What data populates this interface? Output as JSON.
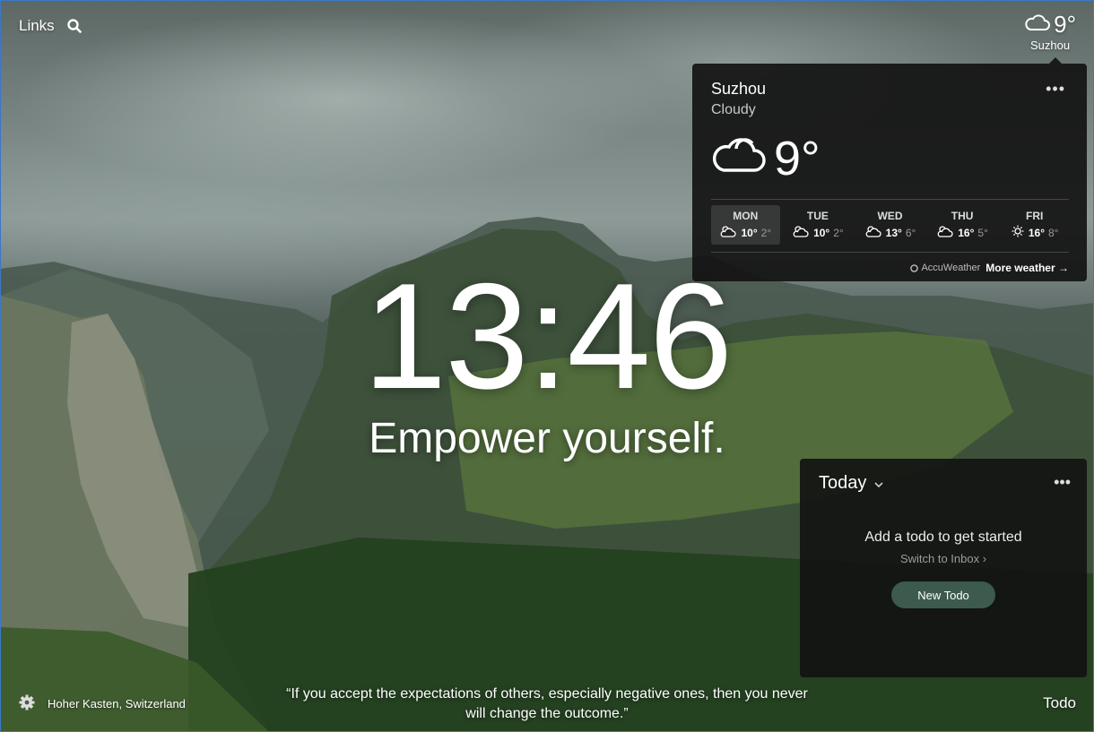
{
  "topbar": {
    "links_label": "Links"
  },
  "weather_mini": {
    "temp": "9°",
    "city": "Suzhou"
  },
  "weather_panel": {
    "city": "Suzhou",
    "condition": "Cloudy",
    "temp": "9°",
    "days": [
      {
        "name": "MON",
        "hi": "10°",
        "lo": "2°",
        "icon": "partly-cloudy-icon"
      },
      {
        "name": "TUE",
        "hi": "10°",
        "lo": "2°",
        "icon": "partly-cloudy-icon"
      },
      {
        "name": "WED",
        "hi": "13°",
        "lo": "6°",
        "icon": "partly-cloudy-icon"
      },
      {
        "name": "THU",
        "hi": "16°",
        "lo": "5°",
        "icon": "partly-cloudy-icon"
      },
      {
        "name": "FRI",
        "hi": "16°",
        "lo": "8°",
        "icon": "sun-icon"
      }
    ],
    "provider": "AccuWeather",
    "more_label": "More weather →"
  },
  "clock": "13:46",
  "mantra": "Empower yourself.",
  "todo": {
    "list_name": "Today",
    "empty_text": "Add a todo to get started",
    "switch_label": "Switch to Inbox ›",
    "new_button": "New Todo"
  },
  "footer": {
    "location": "Hoher Kasten, Switzerland",
    "quote": "“If you accept the expectations of others, especially negative ones, then you never will change the outcome.”",
    "todo_label": "Todo"
  }
}
